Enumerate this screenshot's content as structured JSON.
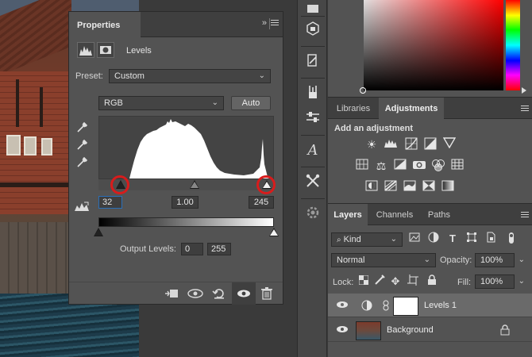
{
  "properties": {
    "tab_label": "Properties",
    "collapse_glyph": "»",
    "adjustment_title": "Levels",
    "preset_label": "Preset:",
    "preset_value": "Custom",
    "channel_value": "RGB",
    "auto_label": "Auto",
    "input_black": "32",
    "input_gamma": "1.00",
    "input_white": "245",
    "output_label": "Output Levels:",
    "output_black": "0",
    "output_white": "255"
  },
  "right": {
    "tabs_top": [
      "Libraries",
      "Adjustments"
    ],
    "active_top_tab": "Adjustments",
    "adjust_hint": "Add an adjustment",
    "tabs_layers": [
      "Layers",
      "Channels",
      "Paths"
    ],
    "filter_kind": "Kind",
    "blend_mode": "Normal",
    "opacity_label": "Opacity:",
    "opacity_value": "100%",
    "lock_label": "Lock:",
    "fill_label": "Fill:",
    "fill_value": "100%",
    "layers": [
      {
        "name": "Levels 1",
        "selected": true
      },
      {
        "name": "Background",
        "selected": false,
        "locked": true
      }
    ]
  },
  "colors": {
    "panel": "#535353",
    "tabbar": "#3f3f3f",
    "highlight_ring": "#d81c1c",
    "focus": "#2a6fb8"
  },
  "icons": {
    "dock": [
      "cube-3d-icon",
      "brush-settings-icon",
      "paint-brushes-icon",
      "sliders-icon",
      "glyph-a-icon",
      "tools-icon",
      "settings-gear-icon"
    ],
    "footer": [
      "clip-to-layer-icon",
      "view-previous-icon",
      "reset-icon",
      "visibility-eye-icon",
      "trash-icon"
    ]
  }
}
